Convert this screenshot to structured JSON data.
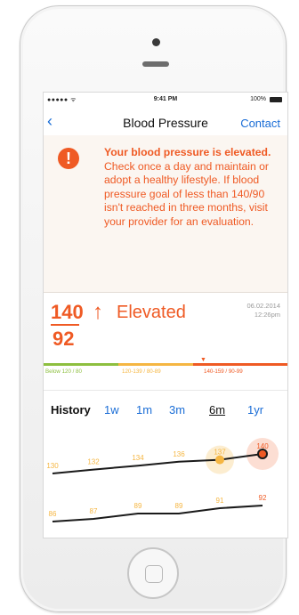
{
  "status_bar": {
    "signal": "●●●●● ᯤ",
    "time": "9:41 PM",
    "battery": "100%"
  },
  "nav": {
    "back": "‹",
    "title": "Blood Pressure",
    "contact": "Contact"
  },
  "alert": {
    "icon": "!",
    "headline": "Your blood pressure is elevated.",
    "message": " Check once a day and maintain or adopt a healthy lifestyle. If blood pressure goal of less than 140/90 isn't reached in three months, visit your provider for an evaluation."
  },
  "reading": {
    "systolic": "140",
    "diastolic": "92",
    "arrow": "↑",
    "status": "Elevated",
    "date": "06.02.2014",
    "time": "12:26pm"
  },
  "ranges": {
    "normal": "Below 120 / 80",
    "prehypertension": "120-139 / 80-89",
    "high": "140-159 / 90-99",
    "marker": "▼"
  },
  "history": {
    "label": "History",
    "tabs": [
      "1w",
      "1m",
      "3m",
      "6m",
      "1yr"
    ],
    "active_tab": "6m"
  },
  "chart_data": {
    "type": "line",
    "series": [
      {
        "values": [
          130,
          132,
          134,
          136,
          137,
          140
        ]
      },
      {
        "values": [
          86,
          87,
          89,
          89,
          91,
          92
        ]
      }
    ],
    "highlighted_point": 140,
    "colors": {
      "normal_label": "#f5b642",
      "high_label": "#ef5a24",
      "line": "#1a1a1a"
    }
  },
  "colors": {
    "accent": "#ef5a24",
    "link": "#1a6dd6"
  }
}
